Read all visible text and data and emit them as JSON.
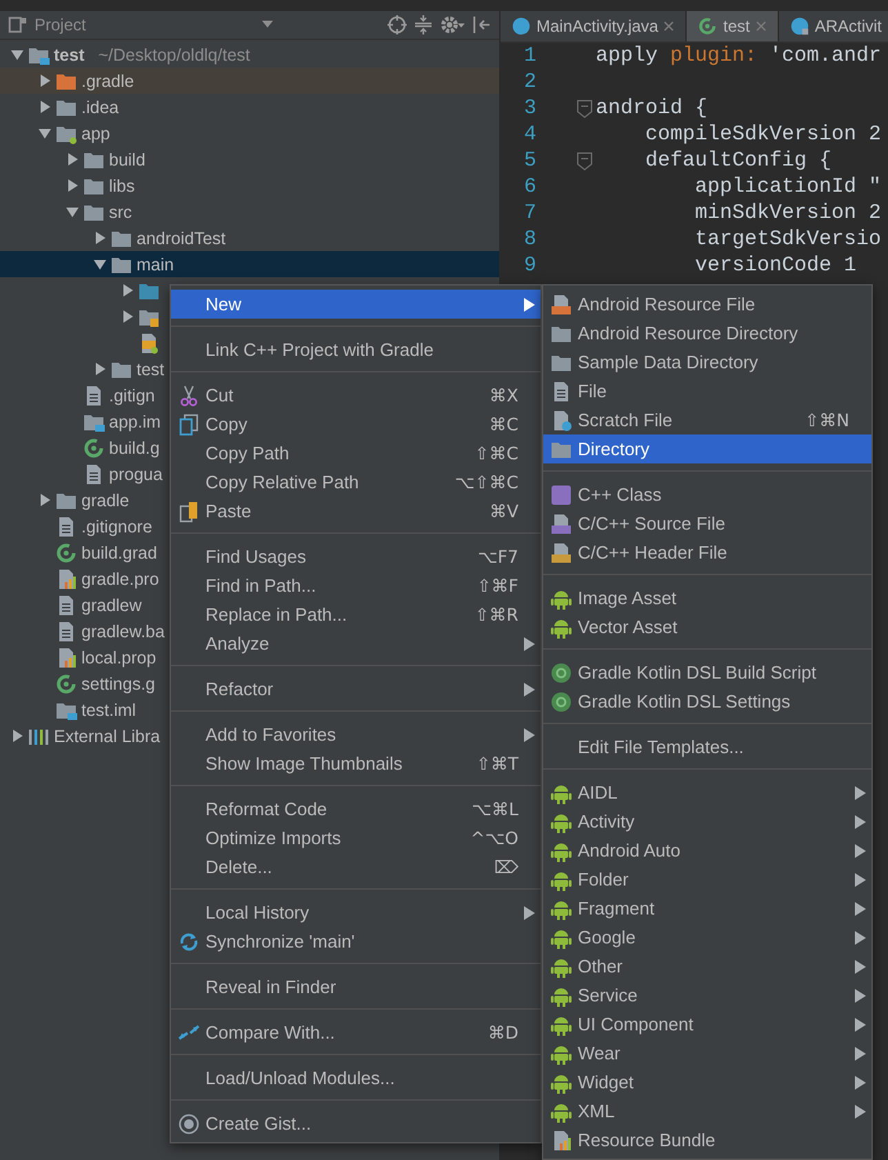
{
  "project_panel": {
    "title": "Project"
  },
  "tree": [
    {
      "label": "test",
      "path": "~/Desktop/oldlq/test",
      "kind": "module",
      "expanded": true,
      "selected": false,
      "children": [
        {
          "label": ".gradle",
          "kind": "excluded-folder",
          "expanded": false,
          "selected": false
        },
        {
          "label": ".idea",
          "kind": "folder",
          "expanded": false,
          "selected": false
        },
        {
          "label": "app",
          "kind": "module-folder",
          "expanded": true,
          "selected": false,
          "children": [
            {
              "label": "build",
              "kind": "folder",
              "expanded": false,
              "selected": false
            },
            {
              "label": "libs",
              "kind": "folder",
              "expanded": false,
              "selected": false
            },
            {
              "label": "src",
              "kind": "folder",
              "expanded": true,
              "selected": false,
              "children": [
                {
                  "label": "androidTest",
                  "kind": "folder",
                  "expanded": false,
                  "selected": false
                },
                {
                  "label": "main",
                  "kind": "folder",
                  "expanded": true,
                  "selected": true,
                  "children": [
                    {
                      "kind": "source-folder",
                      "expanded": false,
                      "selected": false
                    },
                    {
                      "kind": "res-folder",
                      "expanded": false,
                      "selected": false
                    },
                    {
                      "kind": "manifest",
                      "selected": false
                    }
                  ]
                },
                {
                  "label": "test",
                  "kind": "folder",
                  "expanded": false,
                  "selected": false
                }
              ]
            },
            {
              "label": ".gitign",
              "kind": "file",
              "selected": false
            },
            {
              "label": "app.im",
              "kind": "module-file",
              "selected": false
            },
            {
              "label": "build.g",
              "kind": "gradle",
              "selected": false
            },
            {
              "label": "progua",
              "kind": "file",
              "selected": false
            }
          ]
        },
        {
          "label": "gradle",
          "kind": "folder",
          "expanded": false,
          "selected": false
        },
        {
          "label": ".gitignore",
          "kind": "file",
          "selected": false
        },
        {
          "label": "build.grad",
          "kind": "gradle",
          "selected": false
        },
        {
          "label": "gradle.pro",
          "kind": "properties",
          "selected": false
        },
        {
          "label": "gradlew",
          "kind": "file",
          "selected": false
        },
        {
          "label": "gradlew.ba",
          "kind": "file",
          "selected": false
        },
        {
          "label": "local.prop",
          "kind": "properties",
          "selected": false
        },
        {
          "label": "settings.g",
          "kind": "gradle",
          "selected": false
        },
        {
          "label": "test.iml",
          "kind": "module-file",
          "selected": false
        }
      ]
    },
    {
      "label": "External Libra",
      "kind": "libraries",
      "expanded": false,
      "selected": false
    }
  ],
  "editor_tabs": [
    {
      "label": "MainActivity.java",
      "kind": "class",
      "selected": false,
      "closable": true
    },
    {
      "label": "test",
      "kind": "gradle",
      "selected": true,
      "closable": true
    },
    {
      "label": "ARActivit",
      "kind": "class-locked",
      "selected": false,
      "closable": false
    }
  ],
  "code_lines": [
    {
      "number": "1",
      "fold": false,
      "tokens": [
        {
          "text": "apply ",
          "kind": "plain"
        },
        {
          "text": "plugin:",
          "kind": "keyword"
        },
        {
          "text": " 'com.andr",
          "kind": "plain"
        }
      ]
    },
    {
      "number": "2",
      "fold": false
    },
    {
      "number": "3",
      "fold": true,
      "tokens": [
        {
          "text": "android {",
          "kind": "plain"
        }
      ]
    },
    {
      "number": "4",
      "fold": false,
      "tokens": [
        {
          "text": "    compileSdkVersion 2",
          "kind": "plain"
        }
      ]
    },
    {
      "number": "5",
      "fold": true,
      "tokens": [
        {
          "text": "    defaultConfig {",
          "kind": "plain"
        }
      ]
    },
    {
      "number": "6",
      "fold": false,
      "tokens": [
        {
          "text": "        applicationId \"",
          "kind": "plain"
        }
      ]
    },
    {
      "number": "7",
      "fold": false,
      "tokens": [
        {
          "text": "        minSdkVersion 2",
          "kind": "plain"
        }
      ]
    },
    {
      "number": "8",
      "fold": false,
      "tokens": [
        {
          "text": "        targetSdkVersio",
          "kind": "plain"
        }
      ]
    },
    {
      "number": "9",
      "fold": false,
      "tokens": [
        {
          "text": "        versionCode 1",
          "kind": "plain"
        }
      ]
    }
  ],
  "context_menu": {
    "items": [
      {
        "kind": "plain",
        "label": "New",
        "has_submenu": true,
        "selected": true
      },
      {
        "kind": "separator"
      },
      {
        "kind": "plain",
        "label": "Link C++ Project with Gradle",
        "has_submenu": false,
        "selected": false
      },
      {
        "kind": "separator"
      },
      {
        "kind": "cut",
        "label": "Cut",
        "shortcut": "⌘X",
        "has_submenu": false,
        "selected": false
      },
      {
        "kind": "copy",
        "label": "Copy",
        "shortcut": "⌘C",
        "has_submenu": false,
        "selected": false
      },
      {
        "kind": "plain",
        "label": "Copy Path",
        "shortcut": "⇧⌘C",
        "has_submenu": false,
        "selected": false
      },
      {
        "kind": "plain",
        "label": "Copy Relative Path",
        "shortcut": "⌥⇧⌘C",
        "has_submenu": false,
        "selected": false
      },
      {
        "kind": "paste",
        "label": "Paste",
        "shortcut": "⌘V",
        "has_submenu": false,
        "selected": false
      },
      {
        "kind": "separator"
      },
      {
        "kind": "plain",
        "label": "Find Usages",
        "shortcut": "⌥F7",
        "has_submenu": false,
        "selected": false
      },
      {
        "kind": "plain",
        "label": "Find in Path...",
        "shortcut": "⇧⌘F",
        "has_submenu": false,
        "selected": false
      },
      {
        "kind": "plain",
        "label": "Replace in Path...",
        "shortcut": "⇧⌘R",
        "has_submenu": false,
        "selected": false
      },
      {
        "kind": "plain",
        "label": "Analyze",
        "has_submenu": true,
        "selected": false
      },
      {
        "kind": "separator"
      },
      {
        "kind": "plain",
        "label": "Refactor",
        "has_submenu": true,
        "selected": false
      },
      {
        "kind": "separator"
      },
      {
        "kind": "plain",
        "label": "Add to Favorites",
        "has_submenu": true,
        "selected": false
      },
      {
        "kind": "plain",
        "label": "Show Image Thumbnails",
        "shortcut": "⇧⌘T",
        "has_submenu": false,
        "selected": false
      },
      {
        "kind": "separator"
      },
      {
        "kind": "plain",
        "label": "Reformat Code",
        "shortcut": "⌥⌘L",
        "has_submenu": false,
        "selected": false
      },
      {
        "kind": "plain",
        "label": "Optimize Imports",
        "shortcut": "^⌥O",
        "has_submenu": false,
        "selected": false
      },
      {
        "kind": "plain",
        "label": "Delete...",
        "shortcut": "⌦",
        "has_submenu": false,
        "selected": false
      },
      {
        "kind": "separator"
      },
      {
        "kind": "plain",
        "label": "Local History",
        "has_submenu": true,
        "selected": false
      },
      {
        "kind": "sync",
        "label": "Synchronize 'main'",
        "has_submenu": false,
        "selected": false
      },
      {
        "kind": "separator"
      },
      {
        "kind": "plain",
        "label": "Reveal in Finder",
        "has_submenu": false,
        "selected": false
      },
      {
        "kind": "separator"
      },
      {
        "kind": "compare",
        "label": "Compare With...",
        "shortcut": "⌘D",
        "has_submenu": false,
        "selected": false
      },
      {
        "kind": "separator"
      },
      {
        "kind": "plain",
        "label": "Load/Unload Modules...",
        "has_submenu": false,
        "selected": false
      },
      {
        "kind": "separator"
      },
      {
        "kind": "gist",
        "label": "Create Gist...",
        "has_submenu": false,
        "selected": false
      }
    ]
  },
  "submenu": {
    "items": [
      {
        "kind": "resource-file",
        "label": "Android Resource File",
        "has_submenu": false,
        "selected": false
      },
      {
        "kind": "folder",
        "label": "Android Resource Directory",
        "has_submenu": false,
        "selected": false
      },
      {
        "kind": "folder",
        "label": "Sample Data Directory",
        "has_submenu": false,
        "selected": false
      },
      {
        "kind": "file",
        "label": "File",
        "has_submenu": false,
        "selected": false
      },
      {
        "kind": "scratch",
        "label": "Scratch File",
        "shortcut": "⇧⌘N",
        "has_submenu": false,
        "selected": false
      },
      {
        "kind": "folder",
        "label": "Directory",
        "has_submenu": false,
        "selected": true
      },
      {
        "kind": "separator"
      },
      {
        "kind": "cpp-class",
        "label": "C++ Class",
        "has_submenu": false,
        "selected": false
      },
      {
        "kind": "cpp-source",
        "label": "C/C++ Source File",
        "has_submenu": false,
        "selected": false
      },
      {
        "kind": "cpp-header",
        "label": "C/C++ Header File",
        "has_submenu": false,
        "selected": false
      },
      {
        "kind": "separator"
      },
      {
        "kind": "android",
        "label": "Image Asset",
        "has_submenu": false,
        "selected": false
      },
      {
        "kind": "android",
        "label": "Vector Asset",
        "has_submenu": false,
        "selected": false
      },
      {
        "kind": "separator"
      },
      {
        "kind": "gradle-script",
        "label": "Gradle Kotlin DSL Build Script",
        "has_submenu": false,
        "selected": false
      },
      {
        "kind": "gradle-script",
        "label": "Gradle Kotlin DSL Settings",
        "has_submenu": false,
        "selected": false
      },
      {
        "kind": "separator"
      },
      {
        "kind": "plain",
        "label": "Edit File Templates...",
        "has_submenu": false,
        "selected": false
      },
      {
        "kind": "separator"
      },
      {
        "kind": "android",
        "label": "AIDL",
        "has_submenu": true,
        "selected": false
      },
      {
        "kind": "android",
        "label": "Activity",
        "has_submenu": true,
        "selected": false
      },
      {
        "kind": "android",
        "label": "Android Auto",
        "has_submenu": true,
        "selected": false
      },
      {
        "kind": "android",
        "label": "Folder",
        "has_submenu": true,
        "selected": false
      },
      {
        "kind": "android",
        "label": "Fragment",
        "has_submenu": true,
        "selected": false
      },
      {
        "kind": "android",
        "label": "Google",
        "has_submenu": true,
        "selected": false
      },
      {
        "kind": "android",
        "label": "Other",
        "has_submenu": true,
        "selected": false
      },
      {
        "kind": "android",
        "label": "Service",
        "has_submenu": true,
        "selected": false
      },
      {
        "kind": "android",
        "label": "UI Component",
        "has_submenu": true,
        "selected": false
      },
      {
        "kind": "android",
        "label": "Wear",
        "has_submenu": true,
        "selected": false
      },
      {
        "kind": "android",
        "label": "Widget",
        "has_submenu": true,
        "selected": false
      },
      {
        "kind": "android",
        "label": "XML",
        "has_submenu": true,
        "selected": false
      },
      {
        "kind": "bundle",
        "label": "Resource Bundle",
        "has_submenu": false,
        "selected": false
      }
    ]
  }
}
